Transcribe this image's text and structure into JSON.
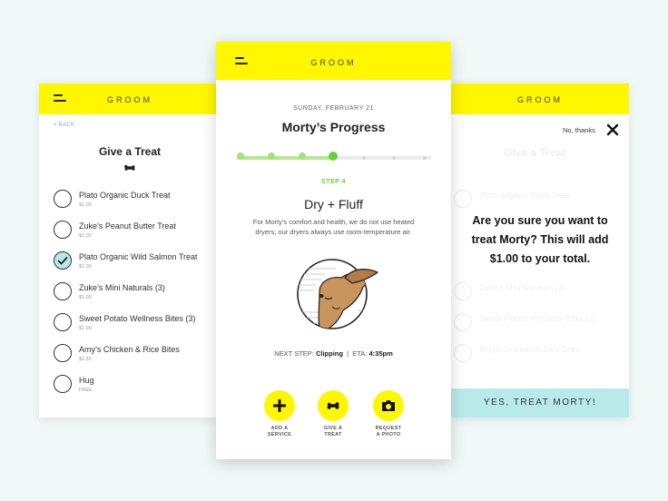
{
  "brand": "GROOM",
  "left": {
    "back": "< BACK",
    "title": "Give a Treat",
    "treats": [
      {
        "name": "Plato Organic Duck Treat",
        "price": "$1.00",
        "checked": false
      },
      {
        "name": "Zuke’s Peanut Butter Treat",
        "price": "$1.00",
        "checked": false
      },
      {
        "name": "Plato Organic Wild Salmon Treat",
        "price": "$1.00",
        "checked": true
      },
      {
        "name": "Zuke’s Mini Naturals (3)",
        "price": "$1.00",
        "checked": false
      },
      {
        "name": "Sweet Potato Wellness Bites (3)",
        "price": "$1.00",
        "checked": false
      },
      {
        "name": "Amy’s Chicken & Rice Bites",
        "price": "$2.50",
        "checked": false
      },
      {
        "name": "Hug",
        "price": "FREE",
        "checked": false
      }
    ]
  },
  "center": {
    "date": "SUNDAY, FEBRUARY 21",
    "title": "Morty’s Progress",
    "progress": {
      "total_steps": 7,
      "current_step": 4
    },
    "step_label": "STEP 4",
    "step_title": "Dry + Fluff",
    "step_desc": "For Morty’s comfort and health, we do not use heated dryers; our dryers always use room-temperature air.",
    "next_step_prefix": "NEXT STEP:",
    "next_step_value": "Clipping",
    "separator": "|",
    "eta_prefix": "ETA:",
    "eta_value": "4:35pm",
    "actions": [
      {
        "line1": "ADD A",
        "line2": "SERVICE",
        "icon": "plus-icon"
      },
      {
        "line1": "GIVE A",
        "line2": "TREAT",
        "icon": "bone-icon"
      },
      {
        "line1": "REQUEST",
        "line2": "A PHOTO",
        "icon": "camera-icon"
      }
    ]
  },
  "right": {
    "no_thanks": "No, thanks",
    "confirm_text": "Are you sure you want to treat Morty? This will add $1.00 to your total.",
    "confirm_button": "YES, TREAT MORTY!"
  },
  "colors": {
    "accent_yellow": "#fff700",
    "progress_green": "#6bcf3a",
    "mint": "#b8eaea",
    "link_blue": "#5bb8d8"
  }
}
